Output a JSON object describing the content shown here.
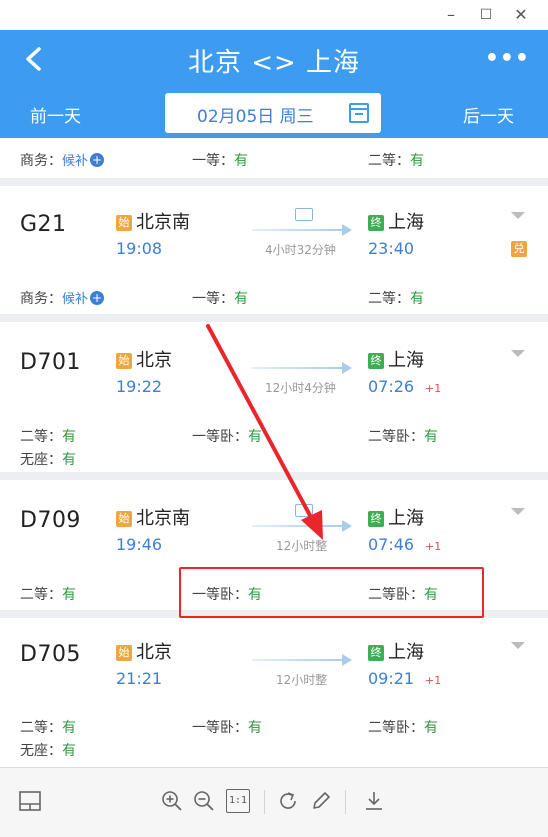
{
  "window": {
    "minimize": "–",
    "maximize": "☐",
    "close": "✕"
  },
  "header": {
    "title": "北京 <> 上海",
    "more": "•••",
    "prev_day": "前一天",
    "next_day": "后一天",
    "date": "02月05日 周三"
  },
  "icons": {
    "back": "chevron-left-icon",
    "calendar": "calendar-icon",
    "more": "ellipsis-icon"
  },
  "colors": {
    "primary": "#3d9cf0",
    "available": "#2f9b3e",
    "waitlist": "#3d7fd6",
    "start_badge": "#f0a640",
    "end_badge": "#3dae53",
    "highlight": "#e8262b"
  },
  "partial_row": {
    "seats": [
      {
        "label": "商务：",
        "value": "候补",
        "type": "waitlist"
      },
      {
        "label": "一等：",
        "value": "有",
        "type": "avail"
      },
      {
        "label": "二等：",
        "value": "有",
        "type": "avail"
      }
    ]
  },
  "trains": [
    {
      "number": "G21",
      "start_badge": "始",
      "from": "北京南",
      "depart": "19:08",
      "end_badge": "终",
      "to": "上海",
      "arrive": "23:40",
      "duration": "4小时32分钟",
      "extra_badge": "兑",
      "seats": [
        {
          "label": "商务：",
          "value": "候补",
          "type": "waitlist"
        },
        {
          "label": "一等：",
          "value": "有",
          "type": "avail"
        },
        {
          "label": "二等：",
          "value": "有",
          "type": "avail"
        }
      ]
    },
    {
      "number": "D701",
      "start_badge": "始",
      "from": "北京",
      "depart": "19:22",
      "end_badge": "终",
      "to": "上海",
      "arrive": "07:26",
      "day_offset": "+1",
      "duration": "12小时4分钟",
      "seats": [
        {
          "label": "二等：",
          "value": "有",
          "type": "avail"
        },
        {
          "label": "一等卧：",
          "value": "有",
          "type": "avail"
        },
        {
          "label": "二等卧：",
          "value": "有",
          "type": "avail"
        },
        {
          "label": "无座：",
          "value": "有",
          "type": "avail"
        }
      ]
    },
    {
      "number": "D709",
      "start_badge": "始",
      "from": "北京南",
      "depart": "19:46",
      "end_badge": "终",
      "to": "上海",
      "arrive": "07:46",
      "day_offset": "+1",
      "duration": "12小时整",
      "seats": [
        {
          "label": "二等：",
          "value": "有",
          "type": "avail"
        },
        {
          "label": "一等卧：",
          "value": "有",
          "type": "avail"
        },
        {
          "label": "二等卧：",
          "value": "有",
          "type": "avail"
        }
      ]
    },
    {
      "number": "D705",
      "start_badge": "始",
      "from": "北京",
      "depart": "21:21",
      "end_badge": "终",
      "to": "上海",
      "arrive": "09:21",
      "day_offset": "+1",
      "duration": "12小时整",
      "seats": [
        {
          "label": "二等：",
          "value": "有",
          "type": "avail"
        },
        {
          "label": "一等卧：",
          "value": "有",
          "type": "avail"
        },
        {
          "label": "二等卧：",
          "value": "有",
          "type": "avail"
        },
        {
          "label": "无座：",
          "value": "有",
          "type": "avail"
        }
      ]
    }
  ],
  "toolbar": {
    "items": [
      "panel-icon",
      "zoom-in-icon",
      "zoom-out-icon",
      "actual-size-icon",
      "rotate-icon",
      "edit-icon",
      "download-icon"
    ],
    "actual_size_label": "1:1"
  }
}
